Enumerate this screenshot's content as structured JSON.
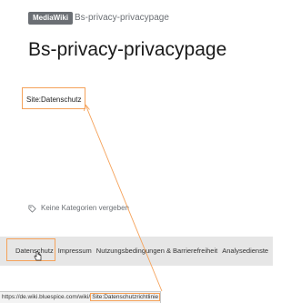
{
  "header": {
    "badge": "MediaWiki",
    "page_name": "Bs-privacy-privacypage"
  },
  "title": "Bs-privacy-privacypage",
  "content": {
    "link": "Site:Datenschutz"
  },
  "categories": {
    "text": "Keine Kategorien vergeben"
  },
  "footer": {
    "links": [
      "Datenschutz",
      "Impressum",
      "Nutzungsbedingungen & Barrierefreiheit",
      "Analysedienste"
    ]
  },
  "statusbar": {
    "url_prefix": "https://de.wiki.bluespice.com/wiki/",
    "url_highlight": "Site:Datenschutzrichtlinie"
  },
  "colors": {
    "highlight": "#f5a25a",
    "badge_bg": "#6b6f74",
    "footer_bg": "#e6e6e6"
  }
}
